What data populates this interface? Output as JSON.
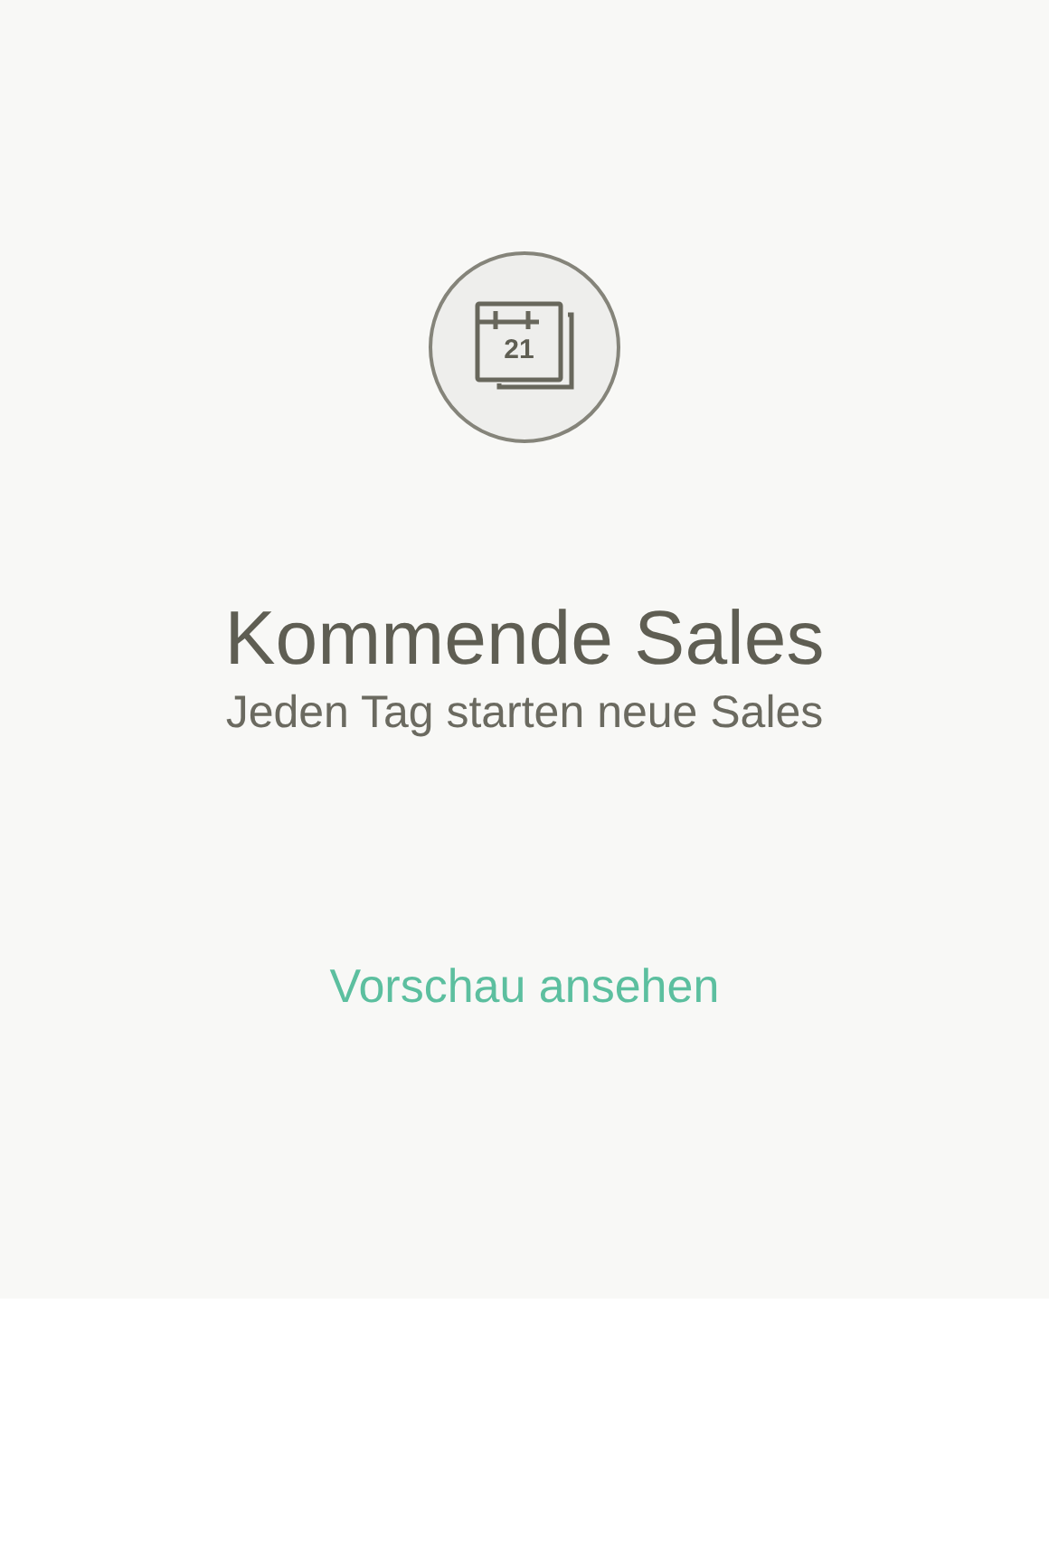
{
  "icon": {
    "day": "21"
  },
  "title": "Kommende Sales",
  "subtitle": "Jeden Tag starten neue Sales",
  "link": "Vorschau ansehen"
}
